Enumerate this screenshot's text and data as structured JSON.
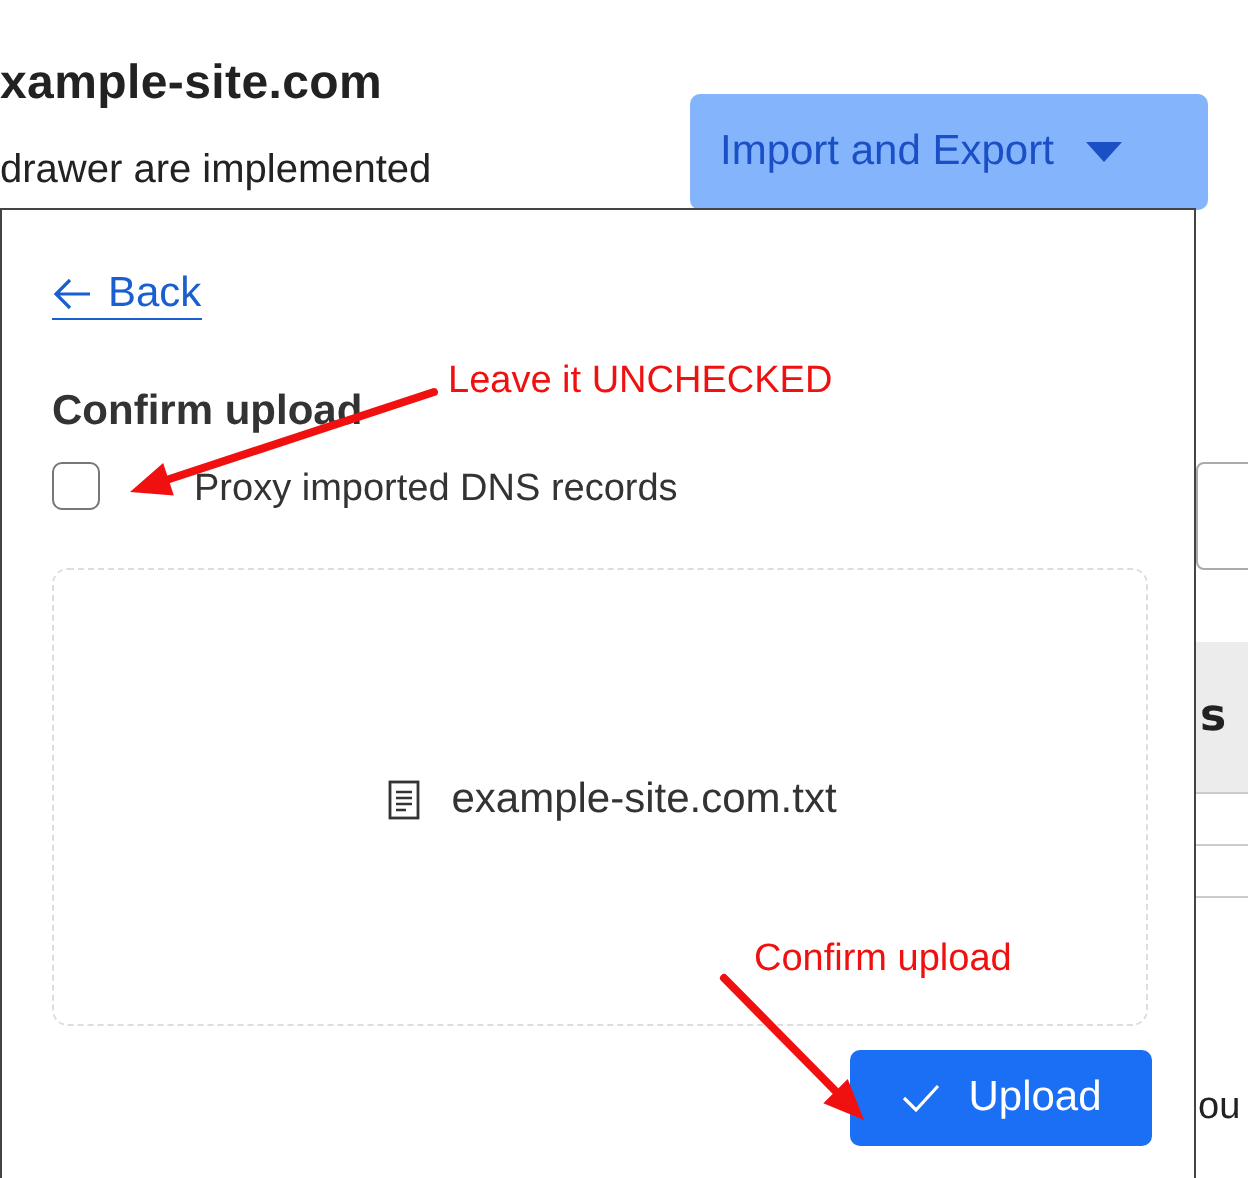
{
  "page": {
    "title": "xample-site.com",
    "subtitle": "drawer are implemented",
    "menu_button": {
      "label": "Import and Export",
      "expanded": true
    },
    "column_fragment": "s",
    "text_fragment": "ou"
  },
  "drawer": {
    "back_link": "Back",
    "heading": "Confirm upload",
    "checkbox": {
      "label": "Proxy imported DNS records",
      "checked": false
    },
    "file_name": "example-site.com.txt",
    "upload_button": "Upload"
  },
  "annotations": [
    {
      "text": "Leave it UNCHECKED"
    },
    {
      "text": "Confirm upload"
    }
  ]
}
